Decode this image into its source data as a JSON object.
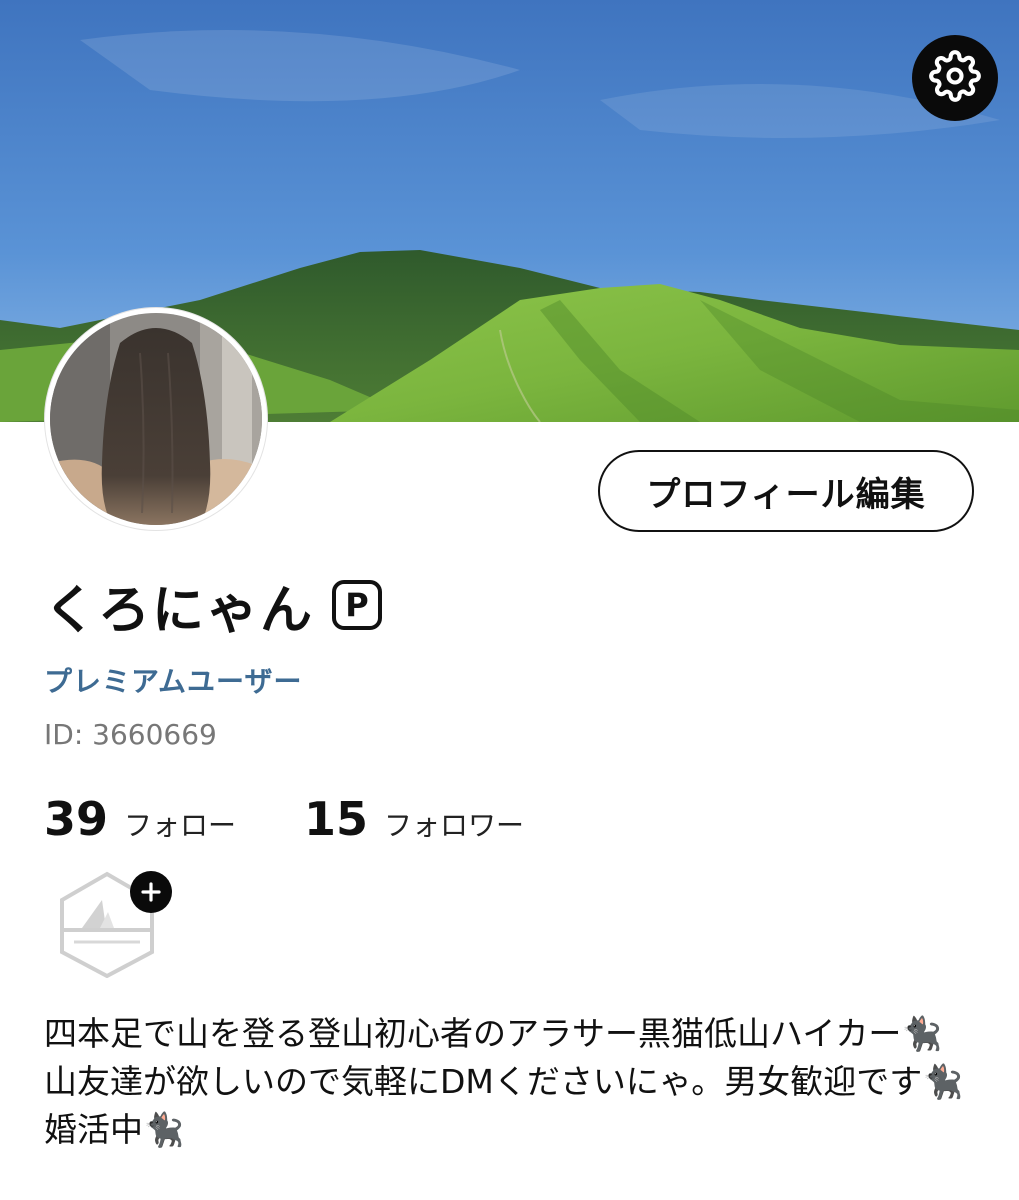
{
  "header": {
    "cover_image": "mountain-landscape-photo",
    "settings_icon": "gear-icon"
  },
  "profile": {
    "avatar": "profile-photo-long-dark-hair",
    "edit_button_label": "プロフィール編集",
    "display_name": "くろにゃん",
    "premium_badge_glyph": "P",
    "premium_label": "プレミアムユーザー",
    "user_id_text": "ID: 3660669",
    "premium_color": "#3e6b93"
  },
  "stats": {
    "following_count": "39",
    "following_label": "フォロー",
    "followers_count": "15",
    "followers_label": "フォロワー"
  },
  "badge": {
    "icon": "mountain-badge-icon",
    "add_icon": "plus-icon"
  },
  "bio": {
    "text": "四本足で山を登る登山初心者のアラサー黒猫低山ハイカー🐈‍⬛ 山友達が欲しいので気軽にDMくださいにゃ。男女歓迎です🐈‍⬛ 婚活中🐈‍⬛"
  }
}
